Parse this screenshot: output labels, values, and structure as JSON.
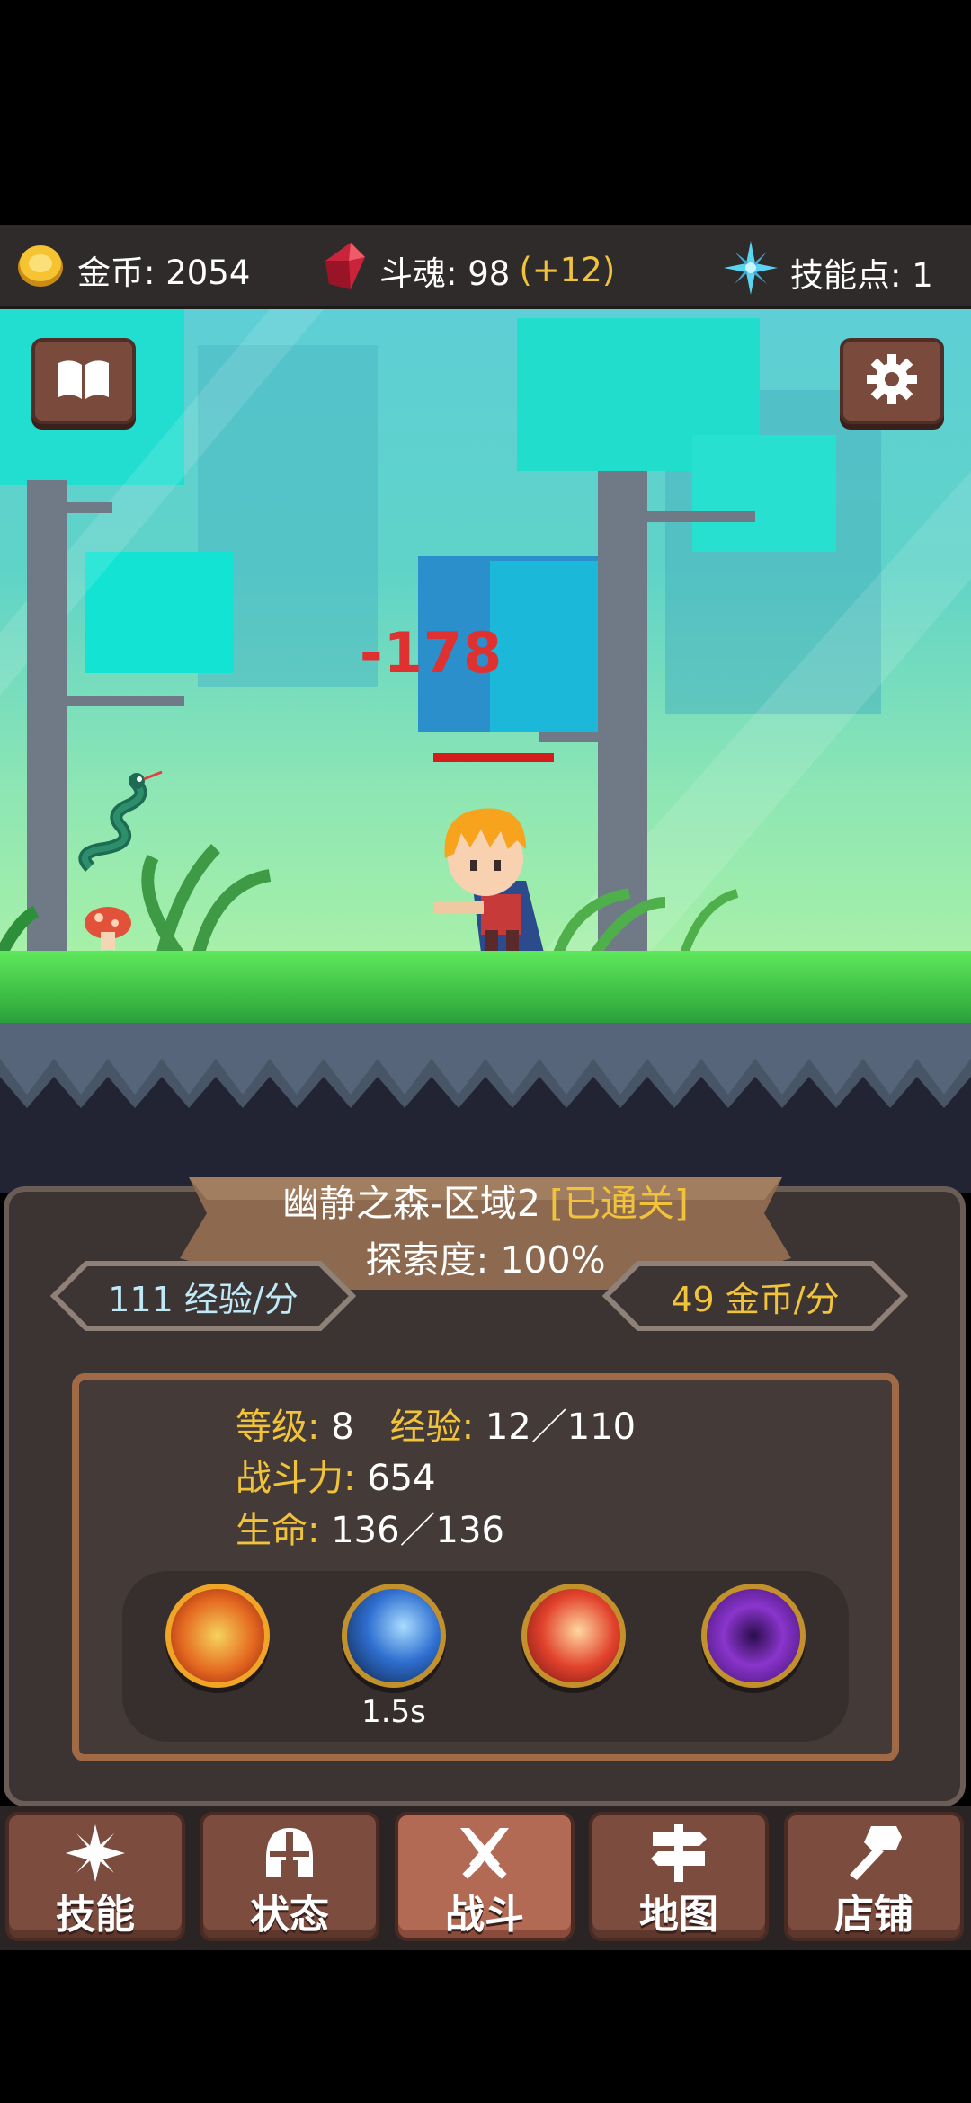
{
  "resources": {
    "gold": {
      "label": "金币: 2054"
    },
    "soul": {
      "label": "斗魂: 98",
      "bonus": "(+12)"
    },
    "skill_points": {
      "label": "技能点: 1"
    }
  },
  "battle": {
    "damage_number": "-178",
    "enemy_hp_fraction": 1.0
  },
  "area": {
    "title": "幽静之森-区域2",
    "status": "[已通关]",
    "exploration": "探索度: 100%",
    "exp_rate": "111  经验/分",
    "gold_rate": "49  金币/分"
  },
  "stats": {
    "level_key": "等级:",
    "level_val": "8",
    "exp_key": "经验:",
    "exp_val": "12／110",
    "power_key": "战斗力:",
    "power_val": "654",
    "life_key": "生命:",
    "life_val": "136／136"
  },
  "skills": [
    {
      "icon": "fire-burst-icon"
    },
    {
      "icon": "ice-claw-icon",
      "cooldown": "1.5s"
    },
    {
      "icon": "flame-slash-icon"
    },
    {
      "icon": "void-vortex-icon"
    }
  ],
  "nav": [
    {
      "label": "技能",
      "icon": "sparkle-icon"
    },
    {
      "label": "状态",
      "icon": "helmet-icon"
    },
    {
      "label": "战斗",
      "icon": "crossed-swords-icon",
      "active": true
    },
    {
      "label": "地图",
      "icon": "signpost-icon"
    },
    {
      "label": "店铺",
      "icon": "hammer-icon"
    }
  ],
  "colors": {
    "accent_gold": "#f1c33b",
    "damage_red": "#e03131",
    "button_brown": "#7c4c3e"
  }
}
